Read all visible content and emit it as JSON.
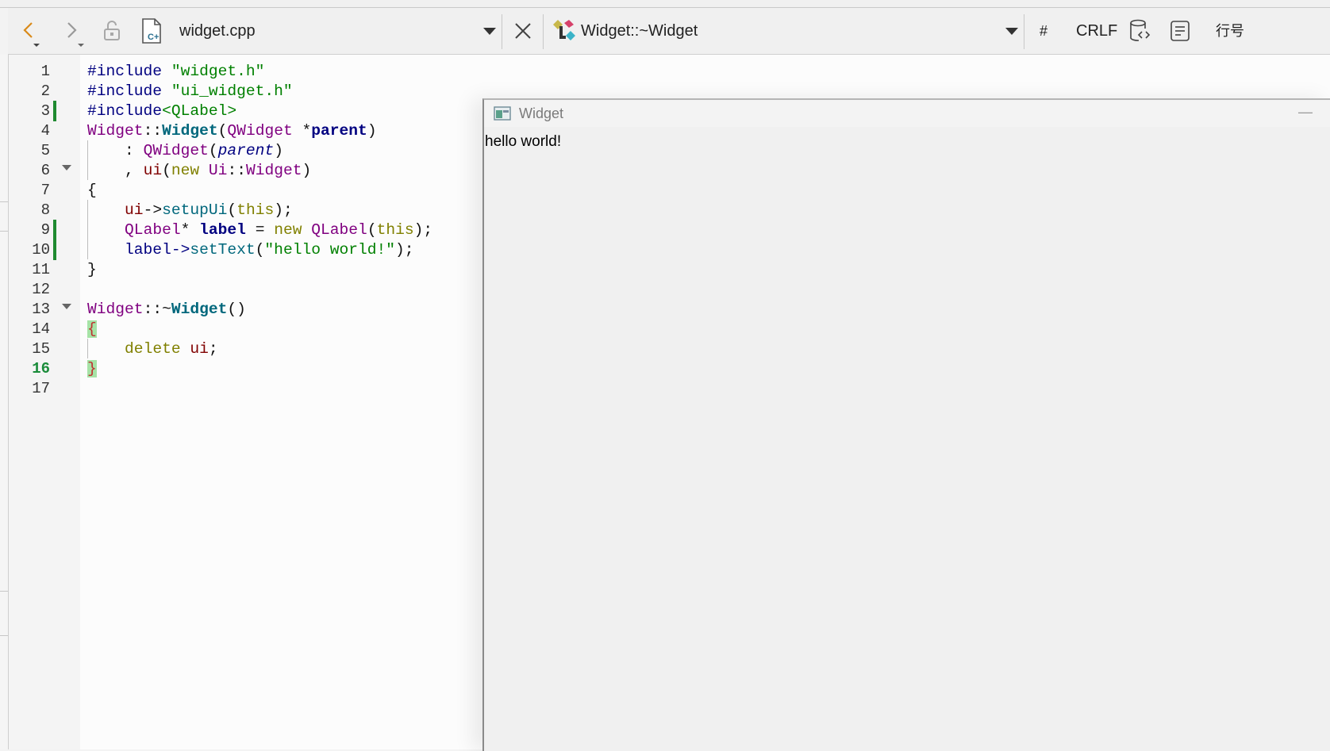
{
  "toolbar": {
    "file_name": "widget.cpp",
    "function_name": "Widget::~Widget",
    "hash_label": "#",
    "line_ending": "CRLF",
    "line_label": "行号"
  },
  "gutter": {
    "line_numbers": [
      "1",
      "2",
      "3",
      "4",
      "5",
      "6",
      "7",
      "8",
      "9",
      "10",
      "11",
      "12",
      "13",
      "14",
      "15",
      "16",
      "17"
    ],
    "current_line": "16"
  },
  "code": {
    "l1": {
      "a": "#include ",
      "b": "\"widget.h\""
    },
    "l2": {
      "a": "#include ",
      "b": "\"ui_widget.h\""
    },
    "l3": {
      "a": "#include",
      "b": "<QLabel>"
    },
    "l4": {
      "a": "Widget",
      "b": "::",
      "c": "Widget",
      "d": "(",
      "e": "QWidget",
      "f": " *",
      "g": "parent",
      "h": ")"
    },
    "l5": {
      "a": "    : ",
      "b": "QWidget",
      "c": "(",
      "d": "parent",
      "e": ")"
    },
    "l6": {
      "a": "    , ",
      "b": "ui",
      "c": "(",
      "d": "new",
      "e": " ",
      "f": "Ui",
      "g": "::",
      "h": "Widget",
      "i": ")"
    },
    "l7": {
      "a": "{"
    },
    "l8": {
      "a": "    ",
      "b": "ui",
      "c": "->",
      "d": "setupUi",
      "e": "(",
      "f": "this",
      "g": ");"
    },
    "l9": {
      "a": "    ",
      "b": "QLabel",
      "c": "* ",
      "d": "label",
      "e": " = ",
      "f": "new",
      "g": " ",
      "h": "QLabel",
      "i": "(",
      "j": "this",
      "k": ");"
    },
    "l10": {
      "a": "    label->",
      "b": "setText",
      "c": "(",
      "d": "\"hello world!\"",
      "e": ");"
    },
    "l11": {
      "a": "}"
    },
    "l13": {
      "a": "Widget",
      "b": "::~",
      "c": "Widget",
      "d": "()"
    },
    "l14": {
      "a": "{"
    },
    "l15": {
      "a": "    ",
      "b": "delete",
      "c": " ",
      "d": "ui",
      "e": ";"
    },
    "l16": {
      "a": "}"
    }
  },
  "app_window": {
    "title": "Widget",
    "minimize_glyph": "—",
    "label_text": "hello world!"
  },
  "colors": {
    "change_marker": "#1f8a30",
    "current_line_number": "#1a8c3a",
    "brace_highlight": "#a6e3a6"
  },
  "icons": [
    "back-arrow-icon",
    "forward-arrow-icon",
    "lock-icon",
    "cpp-file-icon",
    "dropdown-arrow-icon",
    "close-icon",
    "class-symbol-icon",
    "split-view-icon",
    "outline-icon"
  ]
}
